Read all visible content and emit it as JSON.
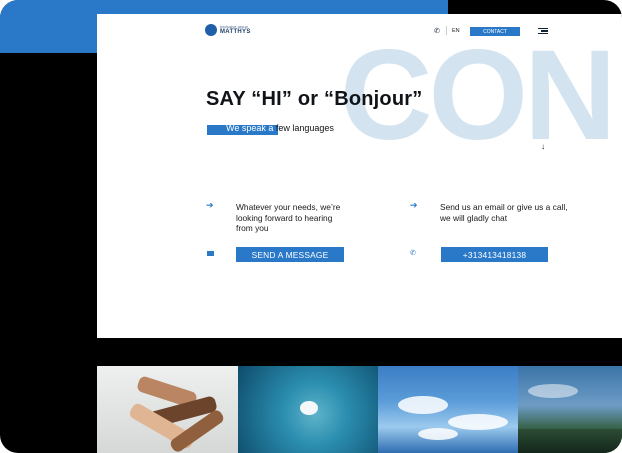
{
  "nav": {
    "logo_top": "exclusive group",
    "logo_name": "MATTHYS",
    "phone_icon": "phone-icon",
    "language": "EN",
    "contact_label": "CONTACT",
    "menu_icon": "hamburger-menu-icon"
  },
  "hero": {
    "background_word": "CON",
    "headline": "SAY “HI” or  “Bonjour”",
    "sub_highlight": "We speak a",
    "sub_rest": " few languages"
  },
  "contact": {
    "left_text": "Whatever your needs, we’re looking forward to hearing from you",
    "left_button": "SEND A MESSAGE",
    "right_text": "Send us an email or give us a call, we will gladly chat",
    "right_button": "+313413418138"
  },
  "colors": {
    "accent": "#2a79c9",
    "background_word": "#d3e4f0"
  }
}
